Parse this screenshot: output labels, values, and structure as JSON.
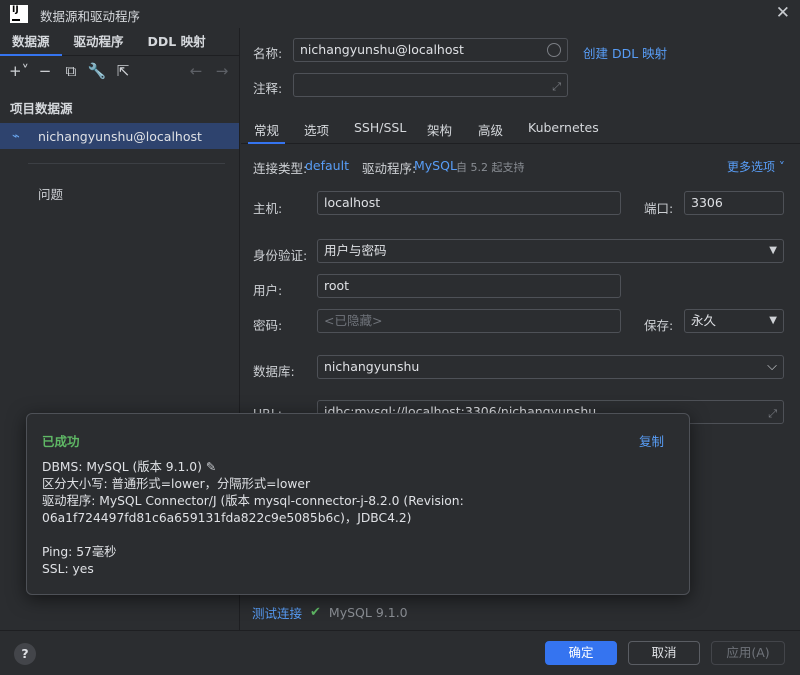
{
  "window": {
    "title": "数据源和驱动程序",
    "close_glyph": "✕"
  },
  "left": {
    "tabs": [
      {
        "label": "数据源",
        "active": true
      },
      {
        "label": "驱动程序",
        "active": false
      },
      {
        "label": "DDL 映射",
        "active": false
      }
    ],
    "toolbar": {
      "add_icon": "+˅",
      "remove_icon": "−",
      "duplicate_icon": "⧉",
      "settings_icon": "🔧",
      "open_icon": "⇱",
      "back_icon": "←",
      "forward_icon": "→"
    },
    "section_title": "项目数据源",
    "datasource_name": "nichangyunshu@localhost",
    "datasource_icon": "⌁",
    "problems_label": "问题"
  },
  "form": {
    "name_label": "名称:",
    "name_value": "nichangyunshu@localhost",
    "create_ddl_link": "创建 DDL 映射",
    "comment_label": "注释:",
    "expand_icon": "⤢",
    "subtabs": [
      "常规",
      "选项",
      "SSH/SSL",
      "架构",
      "高级",
      "Kubernetes"
    ],
    "connection_type_label": "连接类型:",
    "connection_type_value": "default",
    "driver_label": "驱动程序:",
    "driver_value": "MySQL",
    "driver_support": "自 5.2 起支持",
    "more_options": "更多选项 ˅",
    "host_label": "主机:",
    "host_value": "localhost",
    "port_label": "端口:",
    "port_value": "3306",
    "auth_label": "身份验证:",
    "auth_value": "用户与密码",
    "user_label": "用户:",
    "user_value": "root",
    "password_label": "密码:",
    "password_placeholder": "<已隐藏>",
    "save_label": "保存:",
    "save_value": "永久",
    "database_label": "数据库:",
    "database_value": "nichangyunshu",
    "url_label": "URL:",
    "url_value": "jdbc:mysql://localhost:3306/nichangyunshu",
    "dropdown_arrow": "▼",
    "chevron_down": "⌵"
  },
  "popup": {
    "status": "已成功",
    "copy_label": "复制",
    "line1": "DBMS: MySQL (版本 9.1.0)",
    "pencil_icon": "✎",
    "line2": "区分大小写: 普通形式=lower，分隔形式=lower",
    "line3": "驱动程序: MySQL Connector/J (版本 mysql-connector-j-8.2.0 (Revision:",
    "line4": "06a1f724497fd81c6a659131fda822c9e5085b6c)，JDBC4.2)",
    "line5": "Ping: 57毫秒",
    "line6": "SSL: yes"
  },
  "test": {
    "link_label": "测试连接",
    "check_icon": "✔",
    "result": "MySQL 9.1.0"
  },
  "footer": {
    "help_label": "?",
    "ok_label": "确定",
    "cancel_label": "取消",
    "apply_label": "应用(A)"
  }
}
